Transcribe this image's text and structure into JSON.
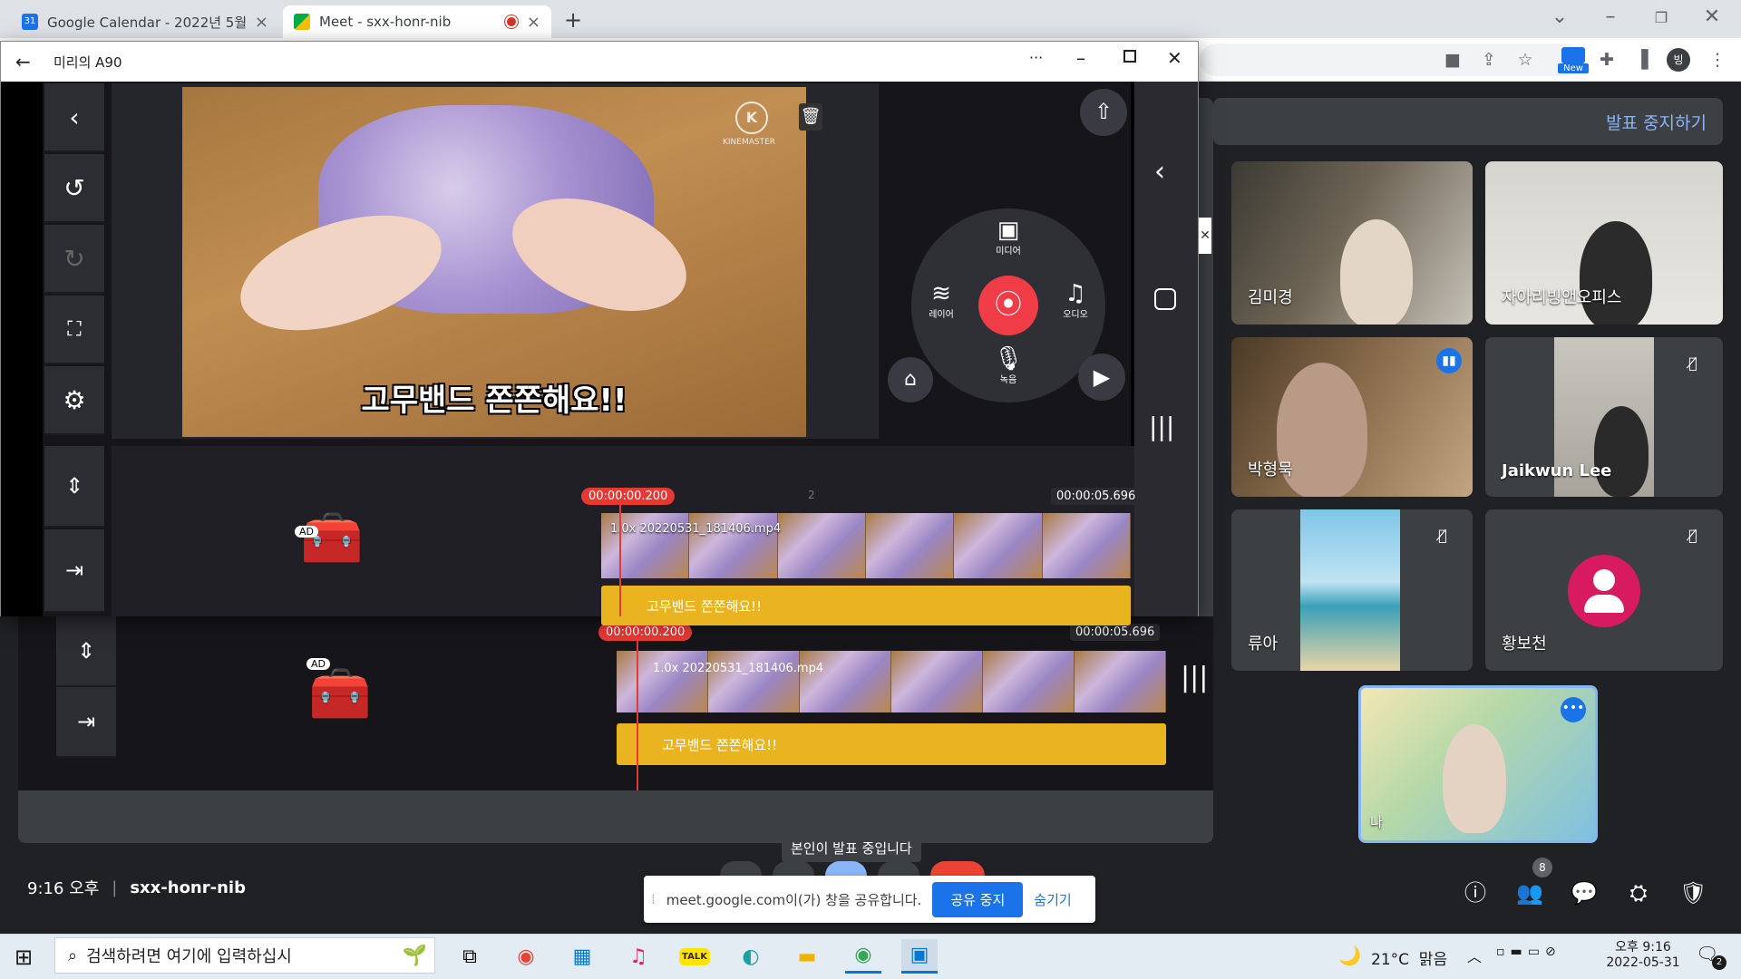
{
  "browser": {
    "tabs": [
      {
        "title": "Google Calendar - 2022년 5월",
        "fav_color": "#1a73e8",
        "fav_text": "31"
      },
      {
        "title": "Meet - sxx-honr-nib",
        "fav_color": "#00ac47",
        "fav_text": ""
      }
    ],
    "new_badge": "New",
    "profile_initial": "빙"
  },
  "app_window": {
    "title": "미리의 A90",
    "menu_dots": "···"
  },
  "kinemaster": {
    "watermark": "KINEMASTER",
    "caption": "고무밴드 쫀쫀해요!!",
    "menu": {
      "media": "미디어",
      "layer": "레이어",
      "audio": "오디오",
      "record": "녹음"
    },
    "ad_label": "AD",
    "timeline_current": "00:00:00.200",
    "timeline_end": "00:00:05.696",
    "ruler_tick": "2",
    "clip_label": "1.0x 20220531_181406.mp4",
    "text_track": "고무밴드 쫀쫀해요!!"
  },
  "meet": {
    "stop_presenting": "발표 중지하기",
    "participants": [
      {
        "name": "김미경",
        "muted": false
      },
      {
        "name": "자아리빙앤오피스",
        "muted": false
      },
      {
        "name": "박형묵",
        "muted": false,
        "speaking": true
      },
      {
        "name": "Jaikwun Lee",
        "muted": true
      },
      {
        "name": "류아",
        "muted": true
      },
      {
        "name": "황보천",
        "muted": true
      },
      {
        "name": "나",
        "muted": false
      }
    ],
    "presenting_notice": "본인이 발표 중입니다",
    "share_text": "meet.google.com이(가) 창을 공유합니다.",
    "share_stop": "공유 중지",
    "share_hide": "숨기기",
    "time": "9:16 오후",
    "meeting_code": "sxx-honr-nib",
    "people_count": "8"
  },
  "taskbar": {
    "search_placeholder": "검색하려면 여기에 입력하십시",
    "weather": "21°C  맑음",
    "clock_time": "오후 9:16",
    "clock_date": "2022-05-31",
    "notif_count": "2"
  }
}
